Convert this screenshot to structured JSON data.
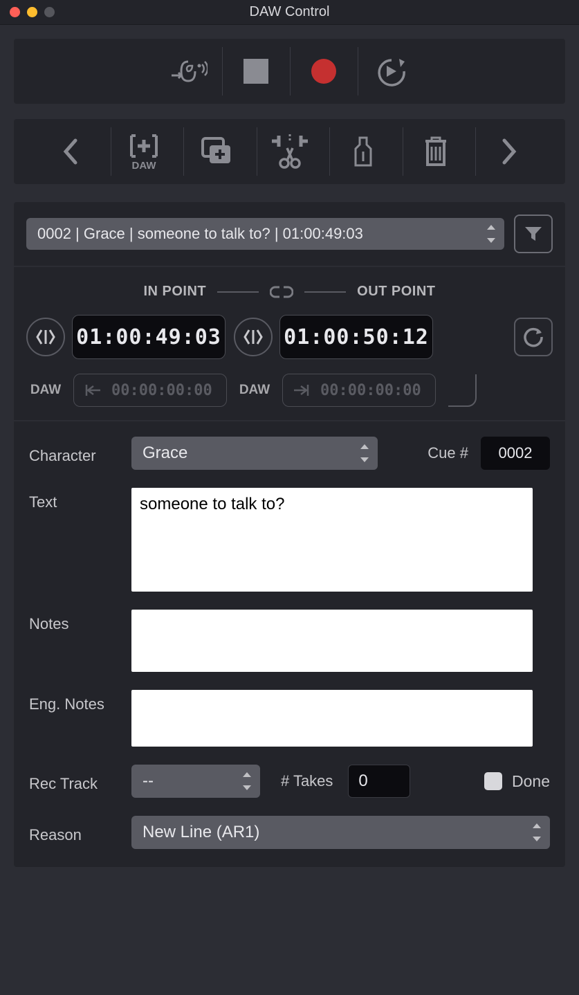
{
  "window": {
    "title": "DAW Control"
  },
  "cue_selector": "0002 | Grace | someone to talk to? | 01:00:49:03",
  "points": {
    "in_label": "IN POINT",
    "out_label": "OUT POINT",
    "in_tc": "01:00:49:03",
    "out_tc": "01:00:50:12",
    "daw_label": "DAW",
    "daw_in": "00:00:00:00",
    "daw_out": "00:00:00:00"
  },
  "form": {
    "character_label": "Character",
    "character_value": "Grace",
    "cue_num_label": "Cue #",
    "cue_num_value": "0002",
    "text_label": "Text",
    "text_value": "someone to talk to?",
    "notes_label": "Notes",
    "notes_value": "",
    "eng_notes_label": "Eng. Notes",
    "eng_notes_value": "",
    "rec_track_label": "Rec Track",
    "rec_track_value": "--",
    "takes_label": "# Takes",
    "takes_value": "0",
    "done_label": "Done",
    "done_checked": false,
    "reason_label": "Reason",
    "reason_value": "New Line (AR1)"
  }
}
